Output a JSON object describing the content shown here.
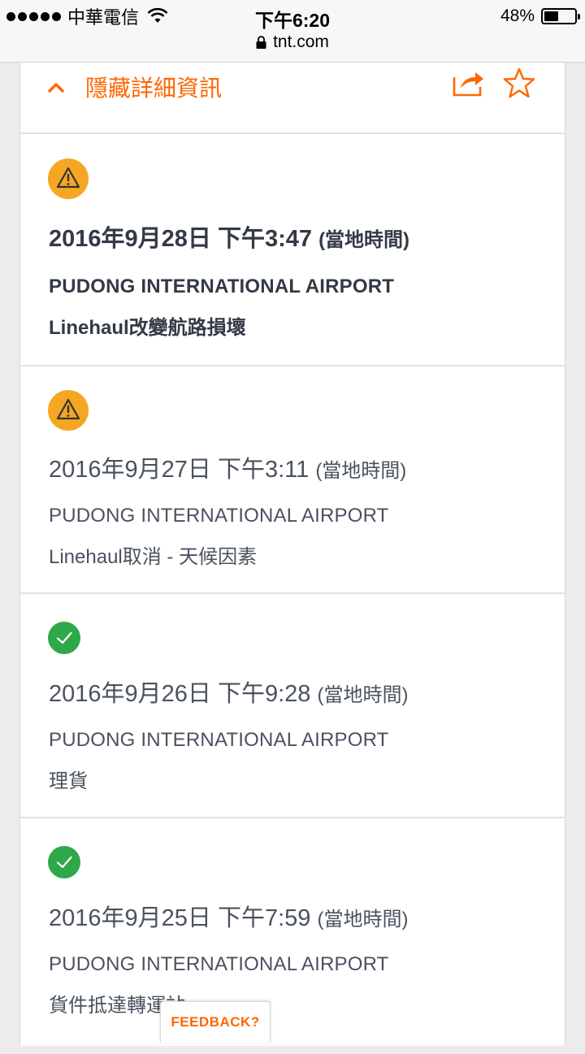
{
  "status_bar": {
    "carrier": "中華電信",
    "time": "下午6:20",
    "battery": "48%",
    "battery_level": 0.48
  },
  "browser": {
    "url": "tnt.com"
  },
  "header": {
    "hide_details_label": "隱藏詳細資訊",
    "icons": [
      "chevron-up-icon",
      "share-icon",
      "star-icon"
    ]
  },
  "colors": {
    "accent": "#ff6600",
    "warning": "#f5a623",
    "success": "#2ea84a",
    "text": "#333a45"
  },
  "events": [
    {
      "icon": "warning-icon",
      "date": "2016年9月28日 下午3:47",
      "local": "(當地時間)",
      "location": "PUDONG INTERNATIONAL AIRPORT",
      "status": "Linehaul改變航路損壞"
    },
    {
      "icon": "warning-icon",
      "date": "2016年9月27日 下午3:11",
      "local": "(當地時間)",
      "location": "PUDONG INTERNATIONAL AIRPORT",
      "status": "Linehaul取消 - 天候因素"
    },
    {
      "icon": "check-icon",
      "date": "2016年9月26日 下午9:28",
      "local": "(當地時間)",
      "location": "PUDONG INTERNATIONAL AIRPORT",
      "status": "理貨"
    },
    {
      "icon": "check-icon",
      "date": "2016年9月25日 下午7:59",
      "local": "(當地時間)",
      "location": "PUDONG INTERNATIONAL AIRPORT",
      "status": "貨件抵達轉運站"
    }
  ],
  "feedback_label": "FEEDBACK?"
}
